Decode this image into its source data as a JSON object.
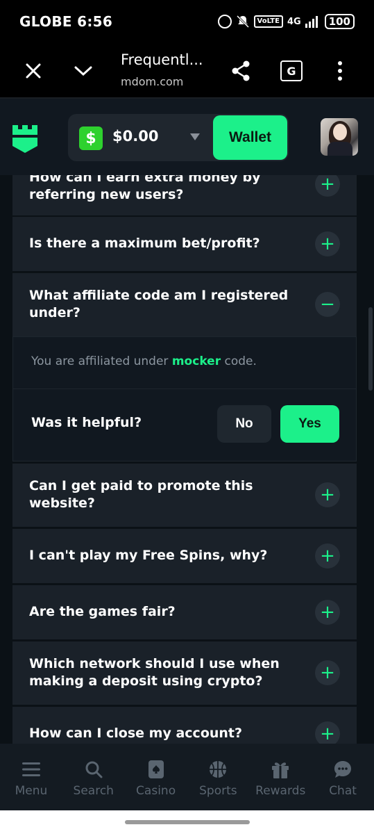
{
  "status_bar": {
    "carrier_time": "GLOBE 6:56",
    "volte": "VoLTE",
    "network": "4G",
    "battery": "100"
  },
  "browser": {
    "title": "Frequentl...",
    "url": "mdom.com",
    "translate_glyph": "G"
  },
  "header": {
    "currency_symbol": "$",
    "balance": "$0.00",
    "wallet_label": "Wallet"
  },
  "faq": {
    "items": [
      {
        "question": "How can I earn extra money by referring new users?",
        "expanded": false
      },
      {
        "question": "Is there a maximum bet/profit?",
        "expanded": false
      },
      {
        "question": "What affiliate code am I registered under?",
        "expanded": true
      },
      {
        "question": "Can I get paid to promote this website?",
        "expanded": false
      },
      {
        "question": "I can't play my Free Spins, why?",
        "expanded": false
      },
      {
        "question": "Are the games fair?",
        "expanded": false
      },
      {
        "question": "Which network should I use when making a deposit using crypto?",
        "expanded": false
      },
      {
        "question": "How can I close my account?",
        "expanded": false
      }
    ],
    "answer": {
      "prefix": "You are affiliated under ",
      "highlight": "mocker",
      "suffix": " code."
    },
    "helpful_label": "Was it helpful?",
    "no_label": "No",
    "yes_label": "Yes",
    "plus_glyph": "+",
    "minus_glyph": "−"
  },
  "nav": {
    "items": [
      {
        "label": "Menu",
        "icon": "menu-icon"
      },
      {
        "label": "Search",
        "icon": "search-icon"
      },
      {
        "label": "Casino",
        "icon": "casino-icon"
      },
      {
        "label": "Sports",
        "icon": "sports-icon"
      },
      {
        "label": "Rewards",
        "icon": "gift-icon"
      },
      {
        "label": "Chat",
        "icon": "chat-icon"
      }
    ]
  },
  "colors": {
    "accent": "#1cf08a",
    "background": "#0b1116",
    "card": "#1a2129"
  }
}
